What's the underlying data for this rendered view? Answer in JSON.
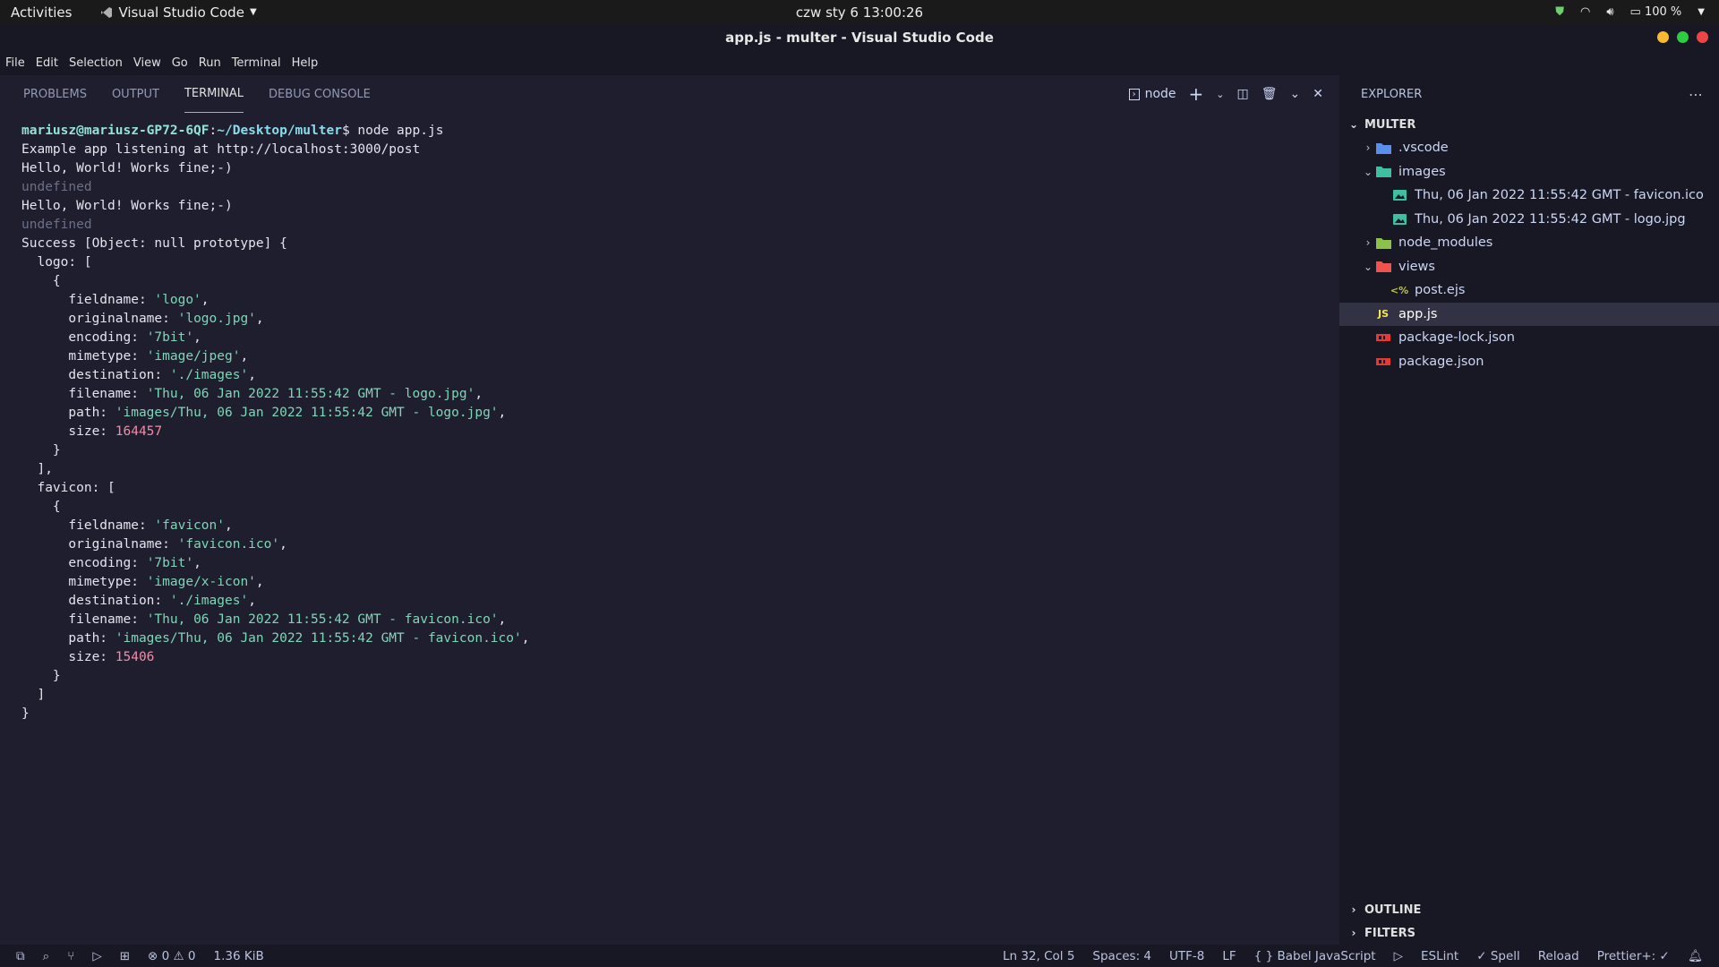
{
  "topbar": {
    "activities": "Activities",
    "app_name": "Visual Studio Code",
    "clock": "czw sty 6  13:00:26",
    "battery": "100 %"
  },
  "window": {
    "title": "app.js - multer - Visual Studio Code",
    "colors": {
      "min": "#f9b82f",
      "max": "#2ecc40",
      "close": "#ef4444"
    }
  },
  "menu": [
    "File",
    "Edit",
    "Selection",
    "View",
    "Go",
    "Run",
    "Terminal",
    "Help"
  ],
  "panel": {
    "tabs": [
      "PROBLEMS",
      "OUTPUT",
      "TERMINAL",
      "DEBUG CONSOLE"
    ],
    "active_tab": "TERMINAL",
    "terminal_name": "node"
  },
  "terminal": {
    "prompt_user": "mariusz@mariusz-GP72-6QF",
    "prompt_sep": ":",
    "prompt_path": "~/Desktop/multer",
    "command": "$ node app.js",
    "lines": [
      {
        "t": "Example app listening at http://localhost:3000/post"
      },
      {
        "t": "Hello, World! Works fine;-)"
      },
      {
        "t": "undefined",
        "dim": true
      },
      {
        "t": "Hello, World! Works fine;-)"
      },
      {
        "t": "undefined",
        "dim": true
      },
      {
        "t": "Success [Object: null prototype] {"
      },
      {
        "t": "  logo: ["
      },
      {
        "t": "    {"
      },
      {
        "k": "      fieldname: ",
        "s": "'logo'",
        "e": ","
      },
      {
        "k": "      originalname: ",
        "s": "'logo.jpg'",
        "e": ","
      },
      {
        "k": "      encoding: ",
        "s": "'7bit'",
        "e": ","
      },
      {
        "k": "      mimetype: ",
        "s": "'image/jpeg'",
        "e": ","
      },
      {
        "k": "      destination: ",
        "s": "'./images'",
        "e": ","
      },
      {
        "k": "      filename: ",
        "s": "'Thu, 06 Jan 2022 11:55:42 GMT - logo.jpg'",
        "e": ","
      },
      {
        "k": "      path: ",
        "s": "'images/Thu, 06 Jan 2022 11:55:42 GMT - logo.jpg'",
        "e": ","
      },
      {
        "k": "      size: ",
        "n": "164457",
        "e": ""
      },
      {
        "t": "    }"
      },
      {
        "t": "  ],"
      },
      {
        "t": "  favicon: ["
      },
      {
        "t": "    {"
      },
      {
        "k": "      fieldname: ",
        "s": "'favicon'",
        "e": ","
      },
      {
        "k": "      originalname: ",
        "s": "'favicon.ico'",
        "e": ","
      },
      {
        "k": "      encoding: ",
        "s": "'7bit'",
        "e": ","
      },
      {
        "k": "      mimetype: ",
        "s": "'image/x-icon'",
        "e": ","
      },
      {
        "k": "      destination: ",
        "s": "'./images'",
        "e": ","
      },
      {
        "k": "      filename: ",
        "s": "'Thu, 06 Jan 2022 11:55:42 GMT - favicon.ico'",
        "e": ","
      },
      {
        "k": "      path: ",
        "s": "'images/Thu, 06 Jan 2022 11:55:42 GMT - favicon.ico'",
        "e": ","
      },
      {
        "k": "      size: ",
        "n": "15406",
        "e": ""
      },
      {
        "t": "    }"
      },
      {
        "t": "  ]"
      },
      {
        "t": "}"
      }
    ]
  },
  "explorer": {
    "title": "EXPLORER",
    "root": "MULTER",
    "tree": [
      {
        "label": ".vscode",
        "type": "folder",
        "depth": 1,
        "expanded": false,
        "icon": "folder-vscode-icon",
        "color": "#5b8def"
      },
      {
        "label": "images",
        "type": "folder",
        "depth": 1,
        "expanded": true,
        "icon": "folder-images-icon",
        "color": "#3fbf9f"
      },
      {
        "label": "Thu, 06 Jan 2022 11:55:42 GMT - favicon.ico",
        "type": "file",
        "depth": 2,
        "icon": "image-file-icon",
        "color": "#3fbf9f"
      },
      {
        "label": "Thu, 06 Jan 2022 11:55:42 GMT - logo.jpg",
        "type": "file",
        "depth": 2,
        "icon": "image-file-icon",
        "color": "#3fbf9f"
      },
      {
        "label": "node_modules",
        "type": "folder",
        "depth": 1,
        "expanded": false,
        "icon": "folder-node-icon",
        "color": "#8bc34a"
      },
      {
        "label": "views",
        "type": "folder",
        "depth": 1,
        "expanded": true,
        "icon": "folder-views-icon",
        "color": "#ef5350"
      },
      {
        "label": "post.ejs",
        "type": "file",
        "depth": 2,
        "icon": "ejs-file-icon",
        "color": "#c0ca33"
      },
      {
        "label": "app.js",
        "type": "file",
        "depth": 1,
        "icon": "js-file-icon",
        "color": "#f9e64f",
        "selected": true
      },
      {
        "label": "package-lock.json",
        "type": "file",
        "depth": 1,
        "icon": "npm-file-icon",
        "color": "#e53935"
      },
      {
        "label": "package.json",
        "type": "file",
        "depth": 1,
        "icon": "npm-file-icon",
        "color": "#e53935"
      }
    ],
    "sections": [
      "OUTLINE",
      "FILTERS"
    ]
  },
  "statusbar": {
    "errors": "0",
    "warnings": "0",
    "size": "1.36 KiB",
    "position": "Ln 32, Col 5",
    "spaces": "Spaces: 4",
    "encoding": "UTF-8",
    "eol": "LF",
    "language": "Babel JavaScript",
    "eslint": "ESLint",
    "spell": "Spell",
    "reload": "Reload",
    "prettier": "Prettier+:"
  }
}
